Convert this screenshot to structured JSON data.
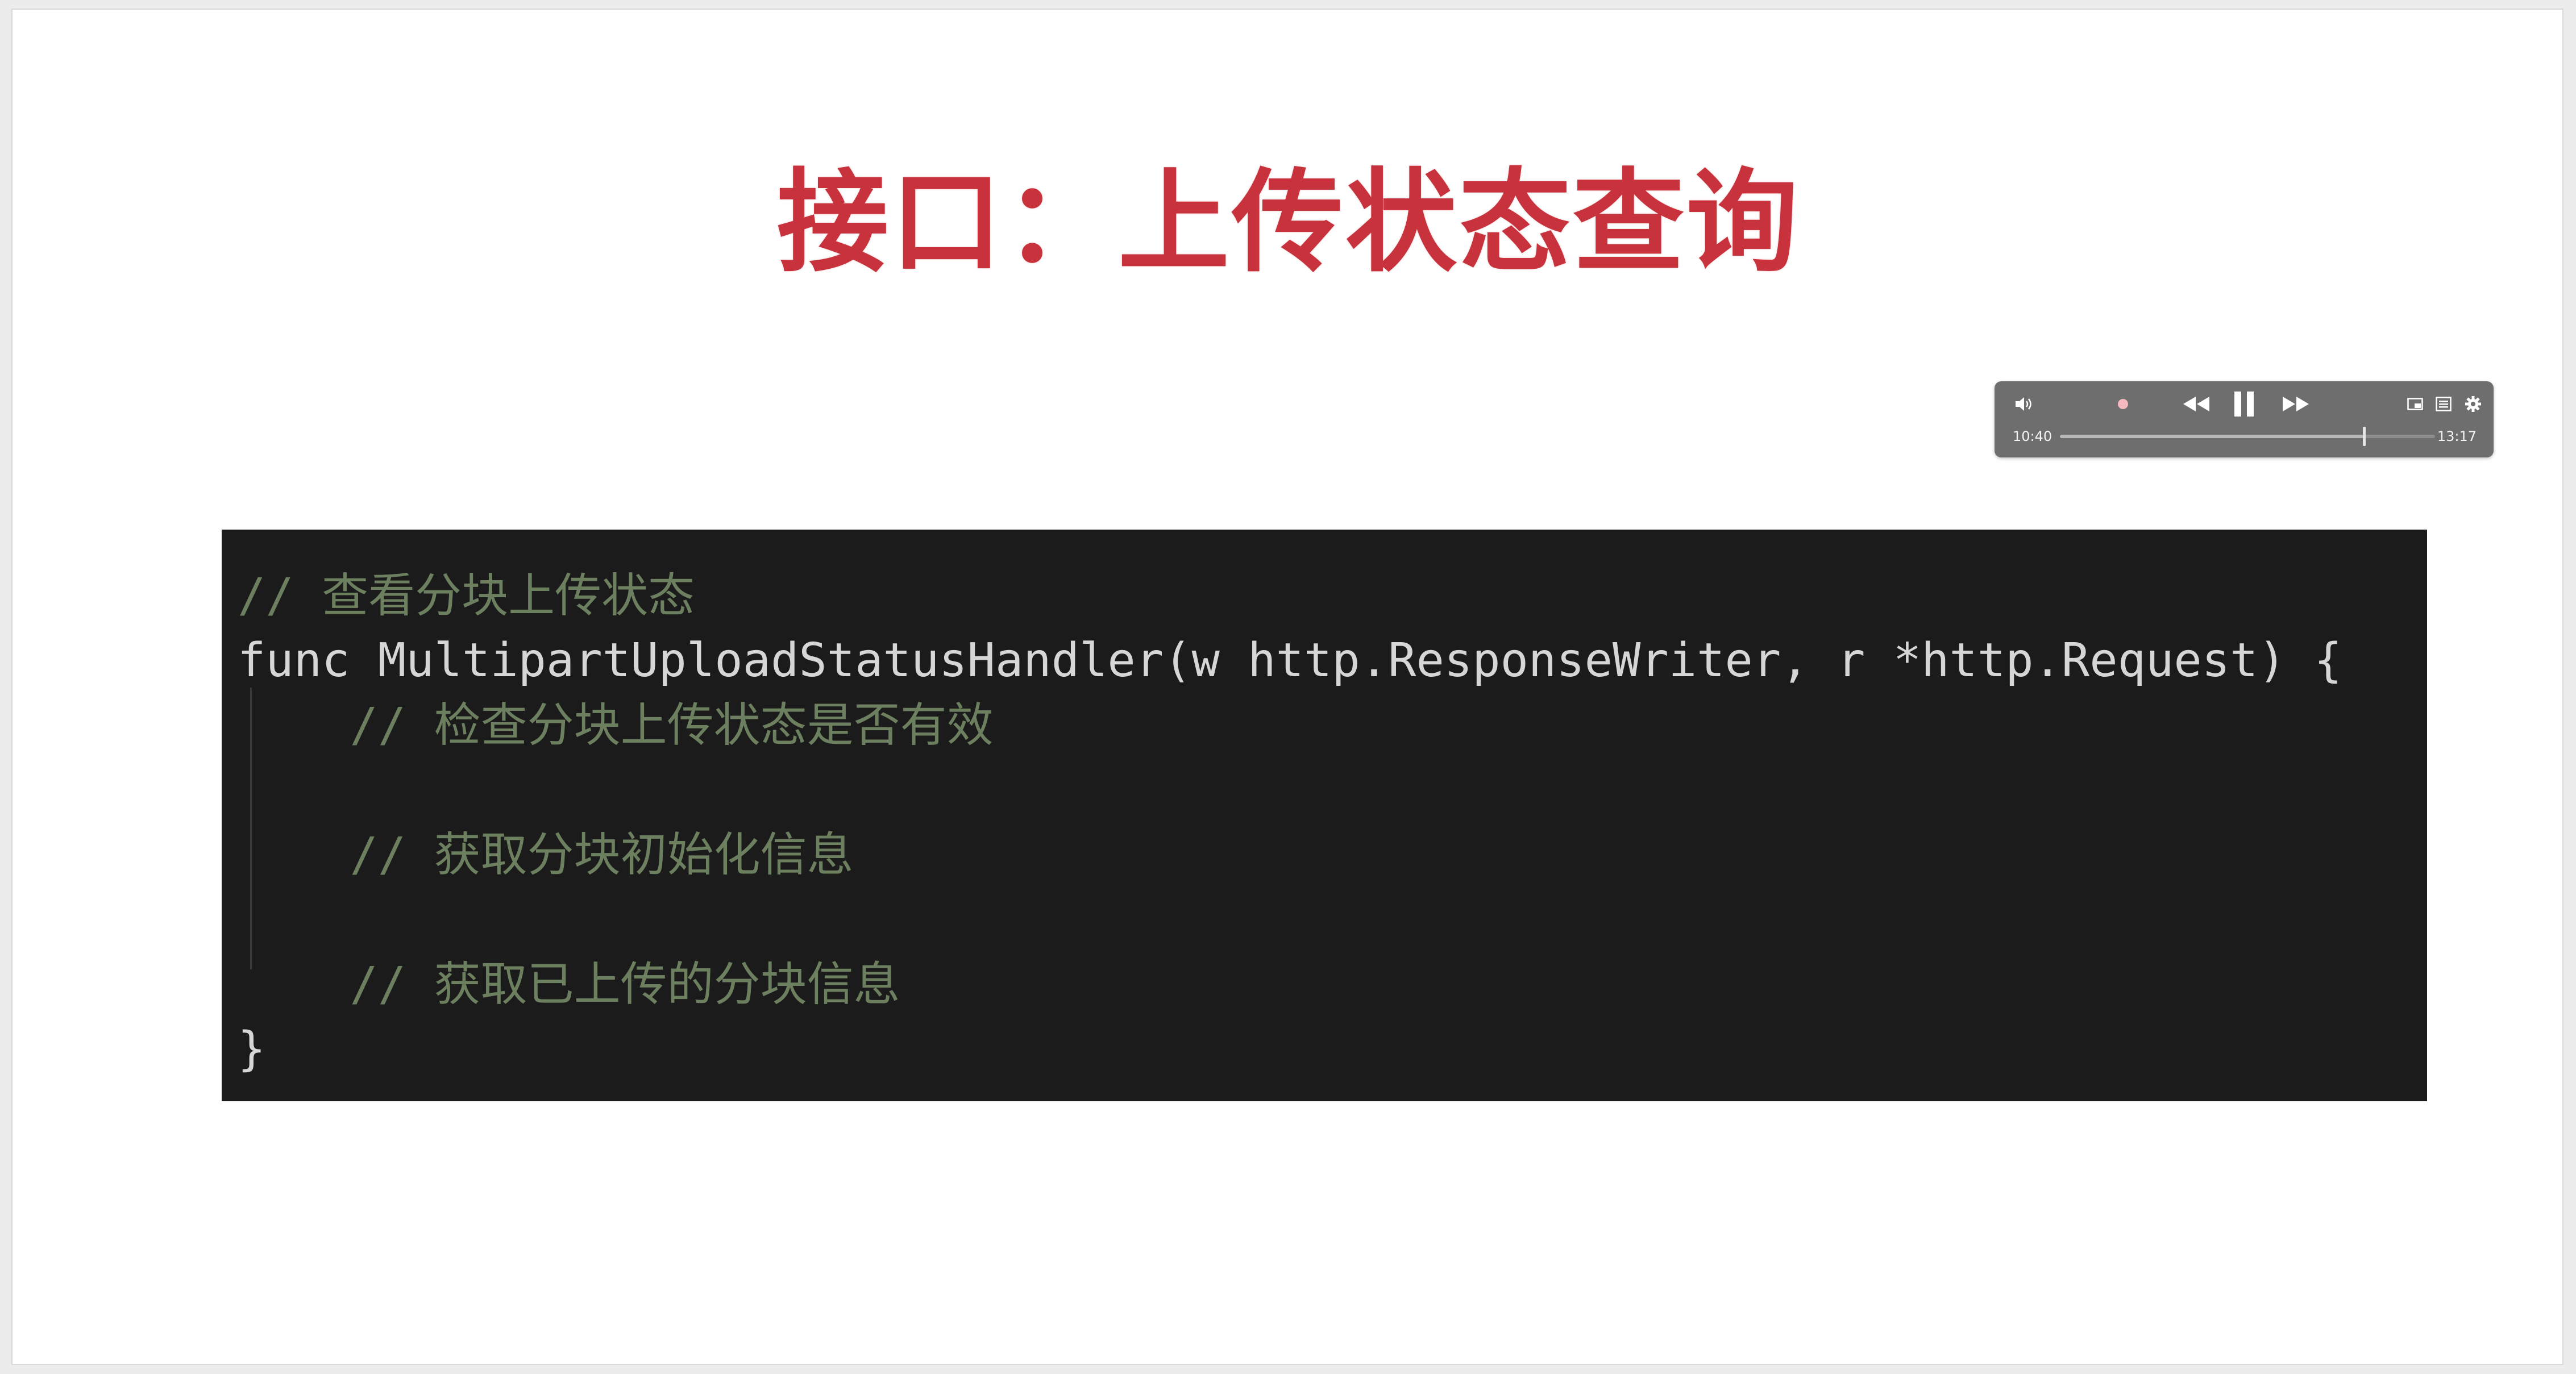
{
  "slide": {
    "title": "接口：上传状态查询",
    "title_color": "#c8323c"
  },
  "player": {
    "current_time": "10:40",
    "total_time": "13:17",
    "progress": 0.81,
    "icons": {
      "volume": "volume-icon",
      "record": "record-dot-icon",
      "rewind": "rewind-icon",
      "pause": "pause-icon",
      "forward": "fast-forward-icon",
      "pip": "picture-in-picture-icon",
      "chapters": "chapters-list-icon",
      "settings": "gear-icon"
    },
    "record_dot_color": "#f4b8bd"
  },
  "code": {
    "background": "#1b1b1b",
    "comment_color": "#6c7f5f",
    "text_color": "#d6d6d6",
    "lines": [
      "// 查看分块上传状态",
      "func MultipartUploadStatusHandler(w http.ResponseWriter, r *http.Request) {",
      "    // 检查分块上传状态是否有效",
      "    // 获取分块初始化信息",
      "    // 获取已上传的分块信息",
      "}"
    ]
  }
}
